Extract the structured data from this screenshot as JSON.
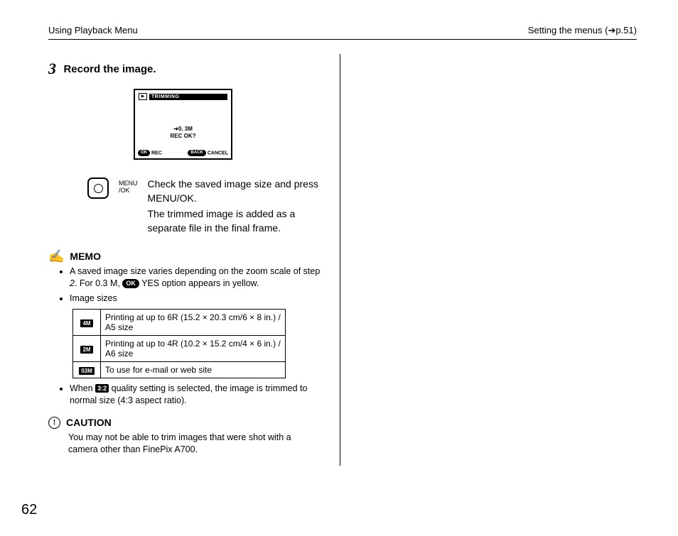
{
  "header": {
    "left": "Using Playback Menu",
    "right_prefix": "Setting the menus (",
    "right_arrow": "➔",
    "right_suffix": "p.51)"
  },
  "step": {
    "num": "3",
    "title": "Record the image."
  },
  "lcd": {
    "trimming": "TRIMMING",
    "play_glyph": "▶",
    "size_arrow": "➜",
    "size_text": "0. 3M",
    "rec_ok": "REC  OK?",
    "ok_pill": "OK",
    "rec_label": "REC",
    "back_pill": "BACK",
    "cancel_label": "CANCEL"
  },
  "button": {
    "menu": "MENU",
    "ok": "/OK"
  },
  "instr": {
    "p1": "Check the saved image size and press MENU/OK.",
    "p2": "The trimmed image is added as a separate file in the final frame."
  },
  "memo": {
    "heading": "MEMO",
    "hand_glyph": "✍",
    "b1a": "A saved image size varies depending on the zoom scale of step ",
    "b1_step": "2",
    "b1b": ". For 0.3 M, ",
    "b1_chip": "OK",
    "b1c": " YES option appears in yellow.",
    "b2": "Image sizes",
    "b3a": "When ",
    "b3_ratio": "3:2",
    "b3b": " quality setting is selected, the image is trimmed to normal size (4:3 aspect ratio)."
  },
  "table": {
    "r1_badge": "4M",
    "r1_text": "Printing at up to 6R (15.2 × 20.3 cm/6 × 8 in.) / A5 size",
    "r2_badge": "2M",
    "r2_text": "Printing at up to 4R (10.2 × 15.2 cm/4 × 6 in.) / A6 size",
    "r3_badge": "03M",
    "r3_text": "To use for e-mail or web site"
  },
  "caution": {
    "heading": "CAUTION",
    "body": "You may not be able to trim images that were shot with a camera other than FinePix A700."
  },
  "page_num": "62"
}
